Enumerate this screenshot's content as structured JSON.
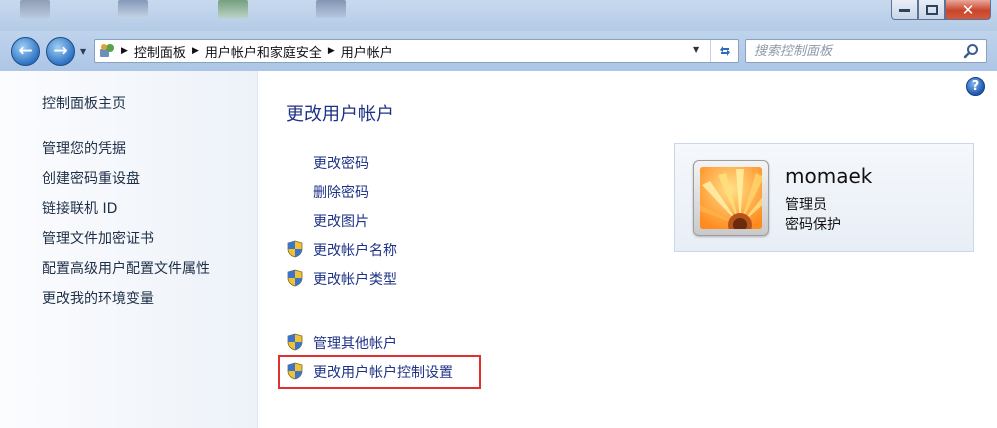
{
  "window": {
    "minimize_icon": "minimize-icon",
    "maximize_icon": "maximize-icon",
    "close_icon": "close-icon"
  },
  "nav": {
    "back_icon": "arrow-left-icon",
    "forward_icon": "arrow-right-icon",
    "breadcrumbs": [
      "控制面板",
      "用户帐户和家庭安全",
      "用户帐户"
    ]
  },
  "search": {
    "placeholder": "搜索控制面板"
  },
  "sidebar": {
    "items": [
      {
        "label": "控制面板主页"
      },
      {
        "label": "管理您的凭据"
      },
      {
        "label": "创建密码重设盘"
      },
      {
        "label": "链接联机 ID"
      },
      {
        "label": "管理文件加密证书"
      },
      {
        "label": "配置高级用户配置文件属性"
      },
      {
        "label": "更改我的环境变量"
      }
    ]
  },
  "main": {
    "title": "更改用户帐户",
    "tasks": [
      {
        "label": "更改密码",
        "shield": false
      },
      {
        "label": "删除密码",
        "shield": false
      },
      {
        "label": "更改图片",
        "shield": false
      },
      {
        "label": "更改帐户名称",
        "shield": true
      },
      {
        "label": "更改帐户类型",
        "shield": true
      }
    ],
    "other_tasks": [
      {
        "label": "管理其他帐户",
        "shield": true
      },
      {
        "label": "更改用户帐户控制设置",
        "shield": true
      }
    ]
  },
  "user": {
    "name": "momaek",
    "role": "管理员",
    "status": "密码保护",
    "picture": "flower-picture"
  },
  "colors": {
    "link": "#1e3287",
    "highlight_border": "#e0312f"
  }
}
